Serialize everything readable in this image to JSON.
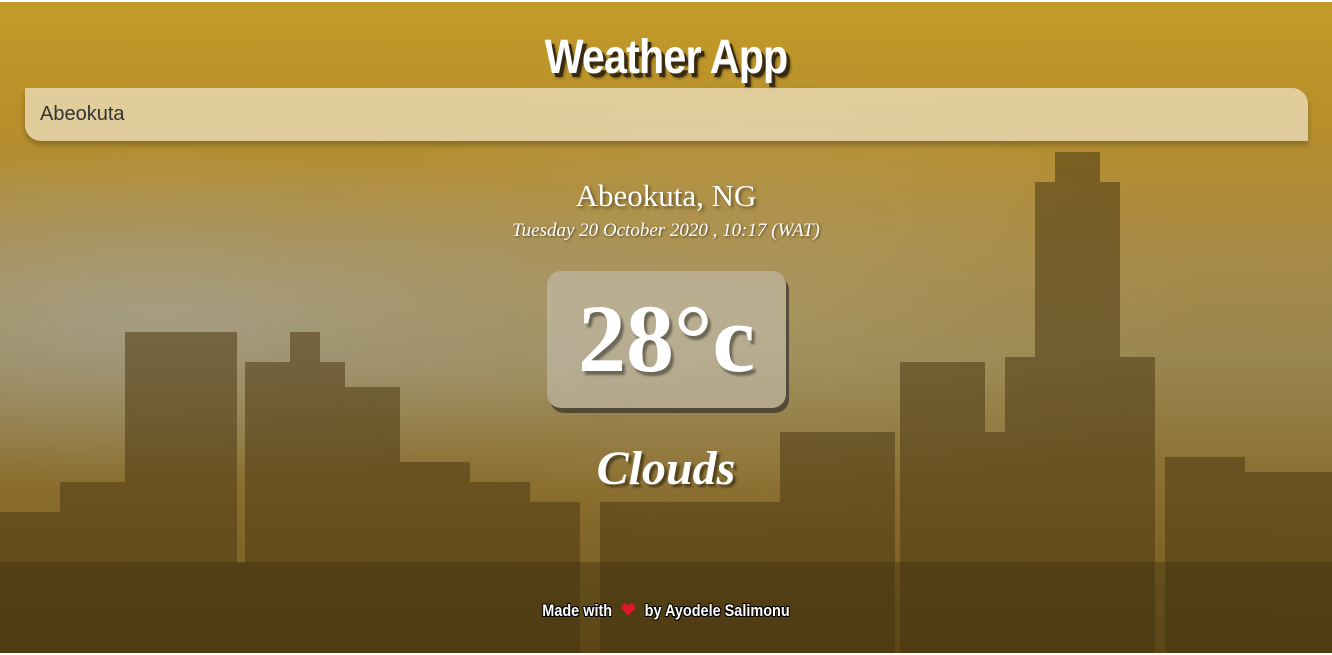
{
  "app": {
    "title": "Weather App"
  },
  "search": {
    "value": "Abeokuta"
  },
  "weather": {
    "location": "Abeokuta, NG",
    "date": "Tuesday 20 October 2020 , 10:17 (WAT)",
    "temperature": "28°c",
    "condition": "Clouds"
  },
  "footer": {
    "prefix": "Made with",
    "heart_icon": "heart-icon",
    "heart_glyph": "❤",
    "suffix": "by Ayodele Salimonu"
  },
  "colors": {
    "heart": "#e0162b",
    "text": "#ffffff",
    "sky_top": "#c39b28"
  }
}
